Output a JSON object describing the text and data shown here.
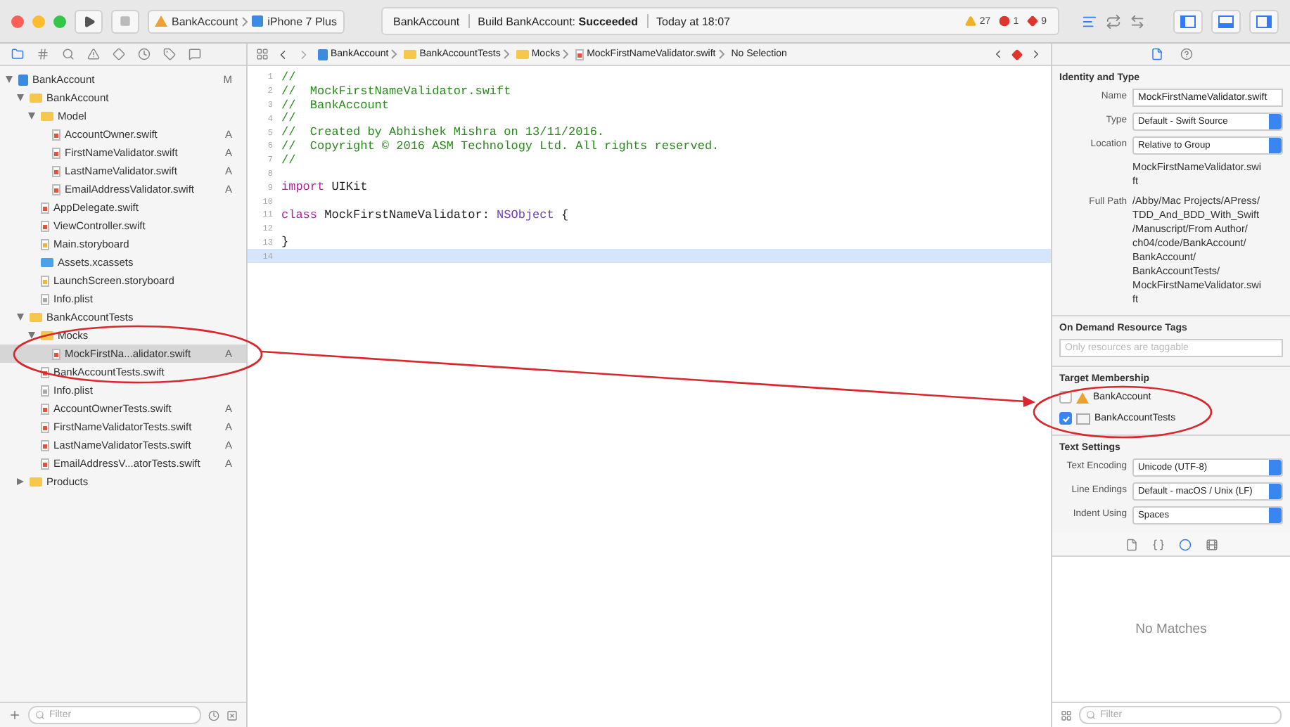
{
  "toolbar": {
    "scheme": "BankAccount",
    "device": "iPhone 7 Plus",
    "activity": {
      "project": "BankAccount",
      "status": "Build BankAccount: **Succeeded**",
      "time": "Today at 18:07"
    },
    "issues": [
      {
        "kind": "warning",
        "count": "27"
      },
      {
        "kind": "error",
        "count": "1"
      },
      {
        "kind": "runtime",
        "count": "9"
      }
    ],
    "editor_modes": [
      {
        "kind": "standard",
        "selected": true
      },
      {
        "kind": "assistant",
        "selected": false
      },
      {
        "kind": "version",
        "selected": false
      }
    ],
    "panels": [
      {
        "kind": "navigator",
        "on": true
      },
      {
        "kind": "debug",
        "on": true
      },
      {
        "kind": "utilities",
        "on": true
      }
    ]
  },
  "navigator": {
    "tabs": [
      {
        "kind": "project",
        "selected": true
      },
      {
        "kind": "symbol",
        "selected": false
      },
      {
        "kind": "find",
        "selected": false
      },
      {
        "kind": "issue",
        "selected": false
      },
      {
        "kind": "test",
        "selected": false
      },
      {
        "kind": "debug",
        "selected": false
      },
      {
        "kind": "breakpoint",
        "selected": false
      },
      {
        "kind": "report",
        "selected": false
      }
    ],
    "tree": [
      {
        "name": "BankAccount",
        "kind": "project",
        "badge": "M",
        "expanded": true,
        "selected": false,
        "children": [
          {
            "name": "BankAccount",
            "kind": "folder",
            "expanded": true,
            "selected": false,
            "children": [
              {
                "name": "Model",
                "kind": "folder",
                "expanded": true,
                "selected": false,
                "children": [
                  {
                    "name": "AccountOwner.swift",
                    "kind": "swift",
                    "badge": "A",
                    "selected": false
                  },
                  {
                    "name": "FirstNameValidator.swift",
                    "kind": "swift",
                    "badge": "A",
                    "selected": false
                  },
                  {
                    "name": "LastNameValidator.swift",
                    "kind": "swift",
                    "badge": "A",
                    "selected": false
                  },
                  {
                    "name": "EmailAddressValidator.swift",
                    "kind": "swift",
                    "badge": "A",
                    "selected": false
                  }
                ]
              },
              {
                "name": "AppDelegate.swift",
                "kind": "swift",
                "selected": false
              },
              {
                "name": "ViewController.swift",
                "kind": "swift",
                "selected": false
              },
              {
                "name": "Main.storyboard",
                "kind": "storyboard",
                "selected": false
              },
              {
                "name": "Assets.xcassets",
                "kind": "assets",
                "selected": false
              },
              {
                "name": "LaunchScreen.storyboard",
                "kind": "storyboard",
                "selected": false
              },
              {
                "name": "Info.plist",
                "kind": "plist",
                "selected": false
              }
            ]
          },
          {
            "name": "BankAccountTests",
            "kind": "folder",
            "expanded": true,
            "selected": false,
            "children": [
              {
                "name": "Mocks",
                "kind": "folder",
                "expanded": true,
                "selected": false,
                "children": [
                  {
                    "name": "MockFirstNa...alidator.swift",
                    "kind": "swift",
                    "badge": "A",
                    "selected": true
                  }
                ]
              },
              {
                "name": "BankAccountTests.swift",
                "kind": "swift",
                "selected": false
              },
              {
                "name": "Info.plist",
                "kind": "plist",
                "selected": false
              },
              {
                "name": "AccountOwnerTests.swift",
                "kind": "swift",
                "badge": "A",
                "selected": false
              },
              {
                "name": "FirstNameValidatorTests.swift",
                "kind": "swift",
                "badge": "A",
                "selected": false
              },
              {
                "name": "LastNameValidatorTests.swift",
                "kind": "swift",
                "badge": "A",
                "selected": false
              },
              {
                "name": "EmailAddressV...atorTests.swift",
                "kind": "swift",
                "badge": "A",
                "selected": false
              }
            ]
          },
          {
            "name": "Products",
            "kind": "folder",
            "expanded": false,
            "selected": false
          }
        ]
      }
    ],
    "filter": {
      "placeholder": "Filter"
    }
  },
  "jump_bar": {
    "path": [
      {
        "kind": "project",
        "label": "BankAccount"
      },
      {
        "kind": "folder",
        "label": "BankAccountTests"
      },
      {
        "kind": "folder",
        "label": "Mocks"
      },
      {
        "kind": "swift",
        "label": "MockFirstNameValidator.swift"
      }
    ],
    "selection": "No Selection"
  },
  "editor": {
    "lines": [
      {
        "number": "1",
        "current": false,
        "tokens": [
          {
            "kind": "comment",
            "text": "//"
          }
        ]
      },
      {
        "number": "2",
        "current": false,
        "tokens": [
          {
            "kind": "comment",
            "text": "//  MockFirstNameValidator.swift"
          }
        ]
      },
      {
        "number": "3",
        "current": false,
        "tokens": [
          {
            "kind": "comment",
            "text": "//  BankAccount"
          }
        ]
      },
      {
        "number": "4",
        "current": false,
        "tokens": [
          {
            "kind": "comment",
            "text": "//"
          }
        ]
      },
      {
        "number": "5",
        "current": false,
        "tokens": [
          {
            "kind": "comment",
            "text": "//  Created by Abhishek Mishra on 13/11/2016."
          }
        ]
      },
      {
        "number": "6",
        "current": false,
        "tokens": [
          {
            "kind": "comment",
            "text": "//  Copyright © 2016 ASM Technology Ltd. All rights reserved."
          }
        ]
      },
      {
        "number": "7",
        "current": false,
        "tokens": [
          {
            "kind": "comment",
            "text": "//"
          }
        ]
      },
      {
        "number": "8",
        "current": false
      },
      {
        "number": "9",
        "current": false,
        "tokens": [
          {
            "kind": "keyword",
            "text": "import"
          },
          {
            "kind": "plain",
            "text": " UIKit"
          }
        ]
      },
      {
        "number": "10",
        "current": false
      },
      {
        "number": "11",
        "current": false,
        "tokens": [
          {
            "kind": "keyword",
            "text": "class"
          },
          {
            "kind": "plain",
            "text": " MockFirstNameValidator: "
          },
          {
            "kind": "type",
            "text": "NSObject"
          },
          {
            "kind": "plain",
            "text": " {"
          }
        ]
      },
      {
        "number": "12",
        "current": false
      },
      {
        "number": "13",
        "current": false,
        "tokens": [
          {
            "kind": "plain",
            "text": "}"
          }
        ]
      },
      {
        "number": "14",
        "current": true
      }
    ]
  },
  "inspector": {
    "tabs": [
      {
        "kind": "file",
        "selected": true
      },
      {
        "kind": "help",
        "selected": false
      }
    ],
    "identity": {
      "title": "Identity and Type",
      "fields": [
        {
          "kind": "text",
          "label": "Name",
          "value": "MockFirstNameValidator.swift"
        },
        {
          "kind": "popup",
          "label": "Type",
          "value": "Default - Swift Source"
        },
        {
          "kind": "popup",
          "label": "Location",
          "value": "Relative to Group"
        },
        {
          "kind": "file",
          "value": "MockFirstNameValidator.swift"
        },
        {
          "kind": "path",
          "label": "Full Path",
          "value": "/Abby/Mac Projects/APress/TDD_And_BDD_With_Swift/Manuscript/From Author/ch04/code/BankAccount/BankAccount/BankAccountTests/MockFirstNameValidator.swift"
        }
      ]
    },
    "tags": {
      "title": "On Demand Resource Tags",
      "placeholder": "Only resources are taggable"
    },
    "membership": {
      "title": "Target Membership",
      "targets": [
        {
          "kind": "app",
          "name": "BankAccount",
          "checked": false
        },
        {
          "kind": "tests",
          "name": "BankAccountTests",
          "checked": true
        }
      ]
    },
    "text_settings": {
      "title": "Text Settings",
      "fields": [
        {
          "label": "Text Encoding",
          "value": "Unicode (UTF-8)"
        },
        {
          "label": "Line Endings",
          "value": "Default - macOS / Unix (LF)"
        },
        {
          "label": "Indent Using",
          "value": "Spaces"
        }
      ]
    },
    "library": {
      "tabs": [
        {
          "kind": "file",
          "selected": false
        },
        {
          "kind": "code",
          "selected": false
        },
        {
          "kind": "object",
          "selected": true
        },
        {
          "kind": "media",
          "selected": false
        }
      ],
      "empty": "No Matches",
      "filter": {
        "placeholder": "Filter"
      }
    }
  }
}
